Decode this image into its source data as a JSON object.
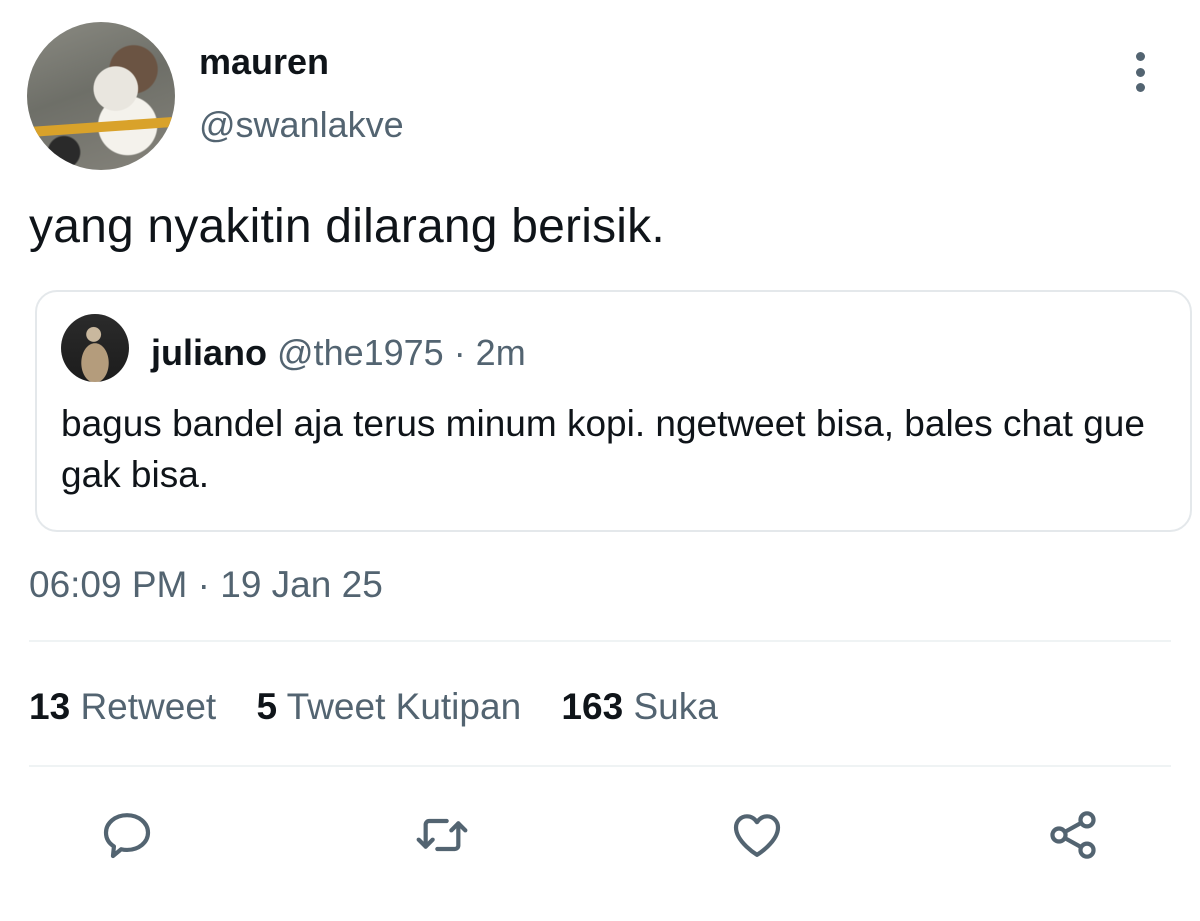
{
  "tweet": {
    "author_name": "mauren",
    "author_handle": "@swanlakve",
    "text": "yang nyakitin dilarang berisik.",
    "timestamp": "06:09 PM · 19 Jan 25"
  },
  "quoted_tweet": {
    "author_name": "juliano",
    "meta": "@the1975 · 2m",
    "text": "bagus bandel aja terus minum kopi. ngetweet bisa, bales chat gue gak bisa."
  },
  "stats": {
    "retweets": {
      "count": "13",
      "label": "Retweet"
    },
    "quotes": {
      "count": "5",
      "label": "Tweet Kutipan"
    },
    "likes": {
      "count": "163",
      "label": "Suka"
    }
  },
  "actions": {
    "reply_icon": "comment-bubble-icon",
    "retweet_icon": "retweet-arrows-icon",
    "like_icon": "heart-icon",
    "share_icon": "share-nodes-icon"
  },
  "colors": {
    "text_primary": "#0f1419",
    "text_secondary": "#536471",
    "divider": "#eff3f4",
    "quote_border": "#e4e8eb"
  }
}
